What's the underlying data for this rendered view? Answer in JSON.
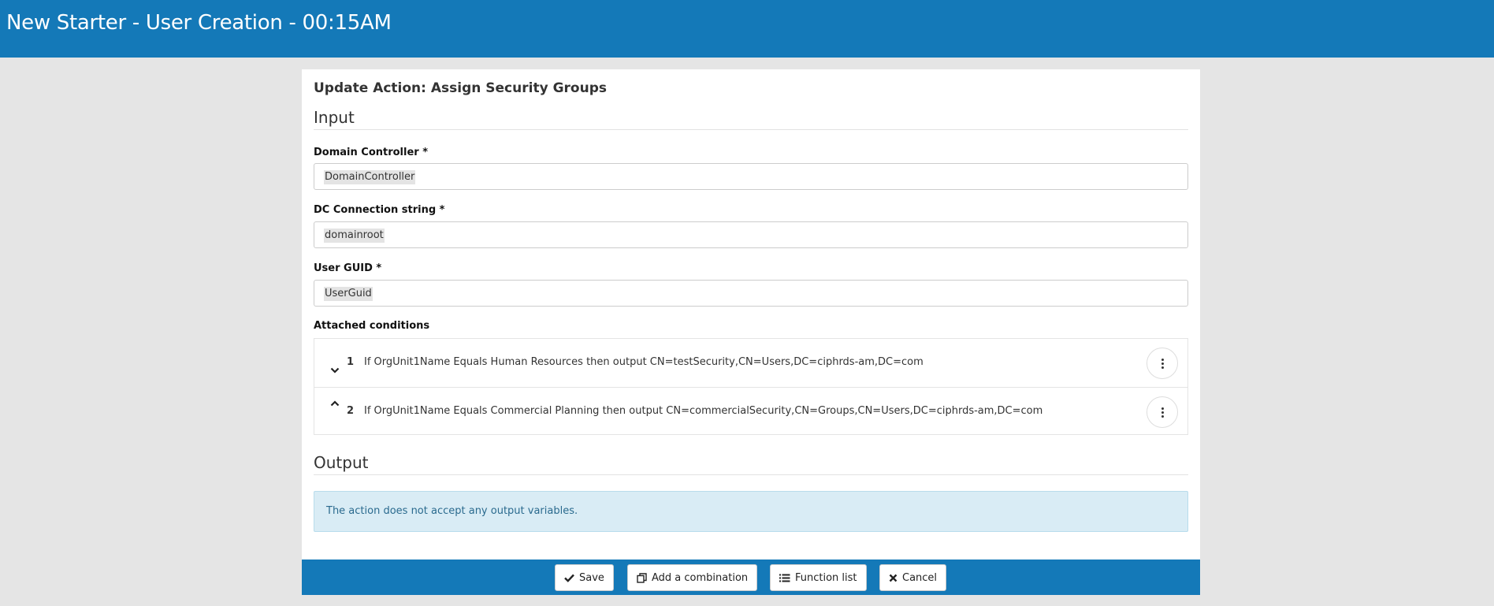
{
  "header": {
    "title": "New Starter - User Creation - 00:15AM"
  },
  "panel": {
    "title": "Update Action: Assign Security Groups",
    "input_section": "Input",
    "output_section": "Output"
  },
  "fields": [
    {
      "label": "Domain Controller *",
      "token": "DomainController"
    },
    {
      "label": "DC Connection string *",
      "token": "domainroot"
    },
    {
      "label": "User GUID *",
      "token": "UserGuid"
    }
  ],
  "conditions": {
    "label": "Attached conditions",
    "items": [
      {
        "number": "1",
        "text": "If OrgUnit1Name Equals Human Resources then output CN=testSecurity,CN=Users,DC=ciphrds-am,DC=com",
        "chevron": "chevron-down-icon"
      },
      {
        "number": "2",
        "text": "If OrgUnit1Name Equals Commercial Planning then output CN=commercialSecurity,CN=Groups,CN=Users,DC=ciphrds-am,DC=com",
        "chevron": "chevron-up-icon"
      }
    ]
  },
  "output": {
    "message": "The action does not accept any output variables."
  },
  "footer": {
    "save": "Save",
    "add_combination": "Add a combination",
    "function_list": "Function list",
    "cancel": "Cancel"
  },
  "colors": {
    "brand": "#1479b8",
    "info_bg": "#d9ecf5",
    "info_text": "#2a6a8e"
  }
}
